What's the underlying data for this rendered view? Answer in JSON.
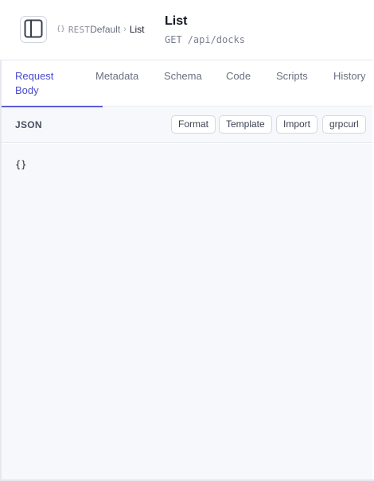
{
  "header": {
    "breadcrumb": {
      "icon_text": "{}",
      "type_label": "REST",
      "collection": "Default",
      "separator": ">",
      "current": "List"
    },
    "title": "List",
    "method": "GET",
    "path": "/api/docks"
  },
  "tabs": [
    {
      "label": "Request Body",
      "active": true
    },
    {
      "label": "Metadata",
      "active": false
    },
    {
      "label": "Schema",
      "active": false
    },
    {
      "label": "Code",
      "active": false
    },
    {
      "label": "Scripts",
      "active": false
    },
    {
      "label": "History",
      "active": false
    }
  ],
  "body_bar": {
    "label": "JSON",
    "buttons": {
      "format": "Format",
      "template": "Template",
      "import": "Import",
      "grpcurl": "grpcurl"
    }
  },
  "editor": {
    "content": "{}"
  },
  "colors": {
    "accent": "#5b5bd6",
    "border": "#e6e8ef",
    "editor_bg": "#f7f8fc"
  }
}
